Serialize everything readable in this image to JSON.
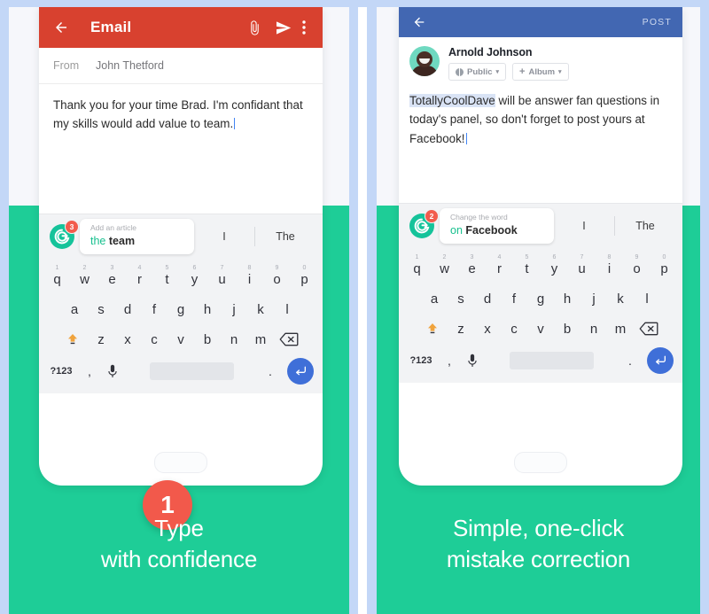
{
  "theme": {
    "frame_blue": "#c3d7f7",
    "green_bg": "#1ecd97",
    "email_red": "#d8412f",
    "facebook_blue": "#4267b2",
    "grammarly_green": "#15c39a",
    "badge_red": "#f25c4d",
    "enter_blue": "#3f6fd8",
    "highlight_blue": "#d9e3f5"
  },
  "left": {
    "app": "email-compose",
    "appbar": {
      "back_icon": "back-arrow-icon",
      "title": "Email",
      "attach_icon": "paperclip-icon",
      "send_icon": "send-icon",
      "overflow_icon": "more-vertical-icon"
    },
    "from": {
      "label": "From",
      "value": "John Thetford"
    },
    "body": {
      "text": "Thank you for your time Brad. I'm confidant that my skills would add value to team."
    },
    "suggestion": {
      "logo_icon": "grammarly-logo-icon",
      "badge_count": "3",
      "hint": "Add an article",
      "replacement_prefix": "the",
      "replacement_rest": "team",
      "word_1": "I",
      "word_2": "The"
    },
    "step_number": "1",
    "caption_line_1": "Type",
    "caption_line_2": "with confidence"
  },
  "right": {
    "app": "facebook-compose",
    "appbar": {
      "back_icon": "back-arrow-icon",
      "post_label": "POST"
    },
    "author": {
      "avatar_icon": "user-avatar",
      "name": "Arnold Johnson",
      "privacy_chip": {
        "icon": "globe-icon",
        "label": "Public",
        "caret": "▾"
      },
      "album_chip": {
        "icon": "plus-icon",
        "label": "Album",
        "caret": "▾"
      }
    },
    "body": {
      "highlighted": "TotallyCoolDave",
      "text": " will be answer fan questions in today's panel, so don't forget to post yours at Facebook!"
    },
    "suggestion": {
      "logo_icon": "grammarly-logo-icon",
      "badge_count": "2",
      "hint": "Change the word",
      "replacement_prefix": "on",
      "replacement_rest": "Facebook",
      "word_1": "I",
      "word_2": "The"
    },
    "caption_line_1": "Simple, one-click",
    "caption_line_2": "mistake correction"
  },
  "keyboard": {
    "row1": [
      {
        "key": "q",
        "num": "1"
      },
      {
        "key": "w",
        "num": "2"
      },
      {
        "key": "e",
        "num": "3"
      },
      {
        "key": "r",
        "num": "4"
      },
      {
        "key": "t",
        "num": "5"
      },
      {
        "key": "y",
        "num": "6"
      },
      {
        "key": "u",
        "num": "7"
      },
      {
        "key": "i",
        "num": "8"
      },
      {
        "key": "o",
        "num": "9"
      },
      {
        "key": "p",
        "num": "0"
      }
    ],
    "row2": [
      "a",
      "s",
      "d",
      "f",
      "g",
      "h",
      "j",
      "k",
      "l"
    ],
    "row3": [
      "z",
      "x",
      "c",
      "v",
      "b",
      "n",
      "m"
    ],
    "shift_icon": "shift-icon",
    "backspace_icon": "backspace-icon",
    "symbols_key": "?123",
    "comma_key": ",",
    "mic_icon": "microphone-icon",
    "space_key": "",
    "period_key": ".",
    "enter_icon": "enter-icon"
  }
}
